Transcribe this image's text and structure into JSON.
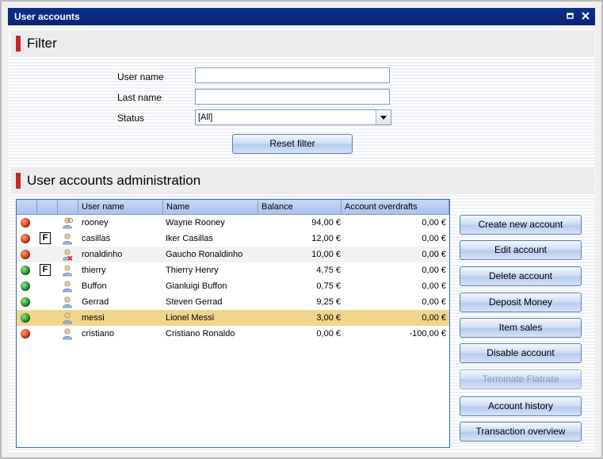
{
  "window": {
    "title": "User accounts"
  },
  "filter": {
    "heading": "Filter",
    "username_label": "User name",
    "username_value": "",
    "lastname_label": "Last name",
    "lastname_value": "",
    "status_label": "Status",
    "status_value": "[All]",
    "reset_label": "Reset filter"
  },
  "admin": {
    "heading": "User accounts administration",
    "columns": [
      "",
      "",
      "",
      "User name",
      "Name",
      "Balance",
      "Account overdrafts"
    ],
    "rows": [
      {
        "status": "red",
        "flatrate": false,
        "icon": "user-online-icon",
        "username": "rooney",
        "name": "Wayne  Rooney",
        "balance": "94,00 €",
        "overdraft": "0,00 €"
      },
      {
        "status": "red",
        "flatrate": true,
        "icon": "user-icon",
        "username": "casillas",
        "name": "Iker  Casillas",
        "balance": "12,00 €",
        "overdraft": "0,00 €"
      },
      {
        "status": "red",
        "flatrate": false,
        "icon": "user-disabled-icon",
        "username": "ronaldinho",
        "name": "Gaucho  Ronaldinho",
        "balance": "10,00 €",
        "overdraft": "0,00 €"
      },
      {
        "status": "green",
        "flatrate": true,
        "icon": "user-icon",
        "username": "thierry",
        "name": "Thierry  Henry",
        "balance": "4,75 €",
        "overdraft": "0,00 €"
      },
      {
        "status": "green",
        "flatrate": false,
        "icon": "user-icon",
        "username": "Buffon",
        "name": "Gianluigi  Buffon",
        "balance": "0,75 €",
        "overdraft": "0,00 €"
      },
      {
        "status": "green",
        "flatrate": false,
        "icon": "user-icon",
        "username": "Gerrad",
        "name": "Steven  Gerrad",
        "balance": "9,25 €",
        "overdraft": "0,00 €"
      },
      {
        "status": "green",
        "flatrate": false,
        "icon": "user-icon",
        "username": "messi",
        "name": "Lionel  Messi",
        "balance": "3,00 €",
        "overdraft": "0,00 €"
      },
      {
        "status": "red",
        "flatrate": false,
        "icon": "user-icon",
        "username": "cristiano",
        "name": "Cristiano  Ronaldo",
        "balance": "0,00 €",
        "overdraft": "-100,00 €"
      }
    ],
    "flatrate_badge": "F",
    "selected_row": 6
  },
  "actions": {
    "create": "Create new  account",
    "edit": "Edit account",
    "delete": "Delete account",
    "deposit": "Deposit Money",
    "item_sales": "Item sales",
    "disable": "Disable account",
    "terminate": "Terminate Flatrate",
    "history": "Account history",
    "transactions": "Transaction overview"
  },
  "colors": {
    "accent": "#c8252a",
    "titlebar": "#0c2f8a",
    "selection": "#f0d68c"
  }
}
